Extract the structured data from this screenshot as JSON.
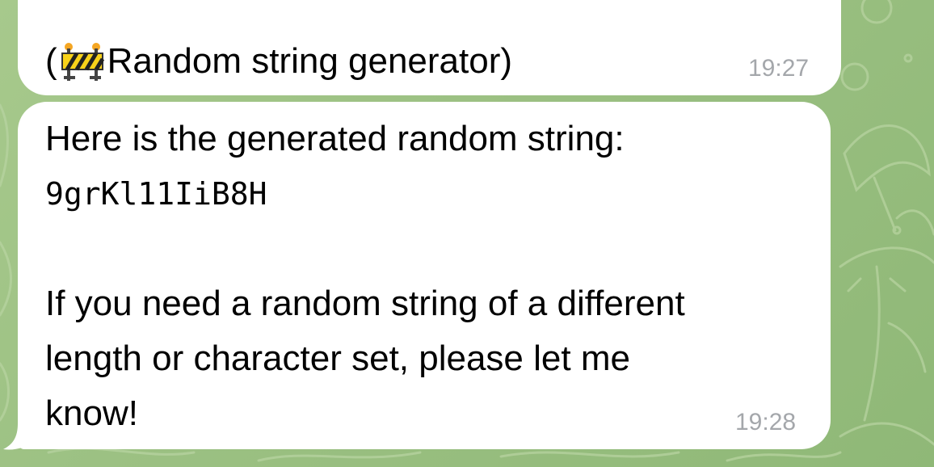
{
  "previous_message": {
    "text_prefix": "(",
    "emoji_icon": "construction-barrier-icon",
    "text": "Random string generator)",
    "time": "19:27"
  },
  "reply_message": {
    "line1": "Here is the generated random string:",
    "random_string": "9grKl11IiB8H",
    "line3": "If you need a random string of a different",
    "line4": "length or character set, please let me",
    "line5": "know!",
    "time": "19:28"
  },
  "colors": {
    "bubble": "#ffffff",
    "wallpaper": "#9cc183",
    "timestamp": "#a4a7ab"
  }
}
